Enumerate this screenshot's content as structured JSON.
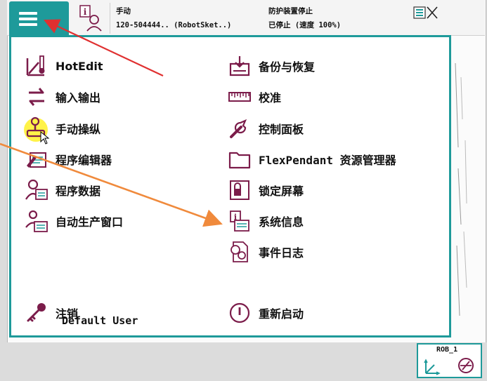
{
  "colors": {
    "accent": "#1e9a9a",
    "icon": "#7b1c4a",
    "arrow_red": "#e03030",
    "arrow_orange": "#f08a3c"
  },
  "header": {
    "mode": "手动",
    "controller": "120-504444.. (RobotSket..)",
    "state": "防护装置停止",
    "speed_state": "已停止 (速度 100%)"
  },
  "menu": {
    "left": [
      {
        "label": "HotEdit",
        "icon": "hotedit-icon"
      },
      {
        "label": "输入输出",
        "icon": "io-arrows-icon"
      },
      {
        "label": "手动操纵",
        "icon": "joystick-icon"
      },
      {
        "label": "程序编辑器",
        "icon": "program-editor-icon"
      },
      {
        "label": "程序数据",
        "icon": "program-data-icon"
      },
      {
        "label": "自动生产窗口",
        "icon": "auto-production-icon"
      }
    ],
    "right": [
      {
        "label": "备份与恢复",
        "icon": "backup-restore-icon"
      },
      {
        "label": "校准",
        "icon": "calibration-icon"
      },
      {
        "label": "控制面板",
        "icon": "wrench-icon"
      },
      {
        "label": "FlexPendant 资源管理器",
        "icon": "folder-icon"
      },
      {
        "label": "锁定屏幕",
        "icon": "lock-icon"
      },
      {
        "label": "系统信息",
        "icon": "system-info-icon"
      },
      {
        "label": "事件日志",
        "icon": "event-log-icon"
      }
    ],
    "logoff": {
      "label": "注销",
      "user": "Default User"
    },
    "restart": {
      "label": "重新启动"
    }
  },
  "robot": {
    "unit": "ROB_1"
  }
}
